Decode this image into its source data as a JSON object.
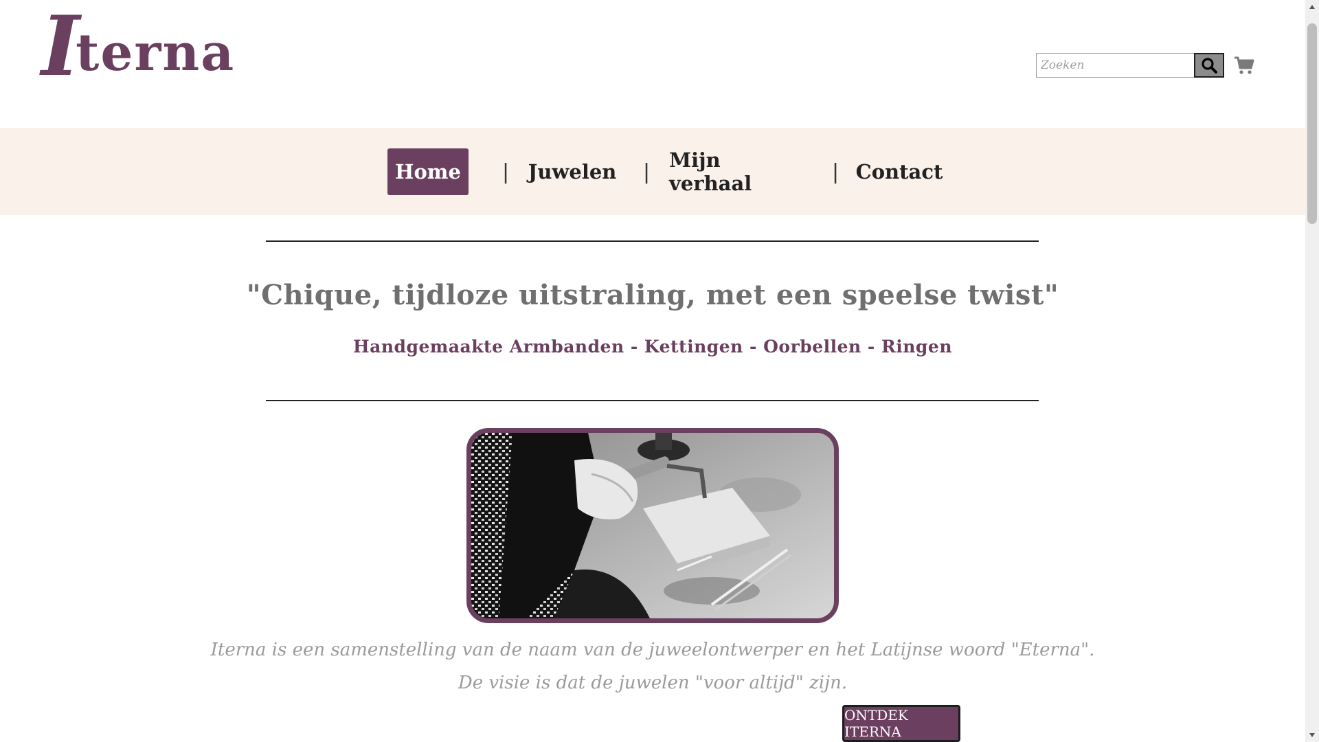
{
  "header": {
    "logo_initial": "I",
    "logo_rest": "terna",
    "search": {
      "placeholder": "Zoeken",
      "value": ""
    },
    "icons": {
      "search": "search-icon",
      "cart": "shopping-cart-icon"
    }
  },
  "nav": {
    "items": [
      {
        "label": "Home",
        "active": true
      },
      {
        "label": "Juwelen",
        "active": false
      },
      {
        "label": "Mijn verhaal",
        "active": false
      },
      {
        "label": "Contact",
        "active": false
      }
    ],
    "separator": "|"
  },
  "hero": {
    "quote": "\"Chique, tijdloze uitstraling, met een speelse twist\"",
    "subtitle": "Handgemaakte Armbanden - Kettingen - Oorbellen - Ringen"
  },
  "intro": {
    "line1": "Iterna is een samenstelling van de naam van de juweelontwerper en het Latijnse woord \"Eterna\".",
    "line2": "De visie is dat de juwelen \"voor altijd\" zijn."
  },
  "cta": {
    "label": "ONTDEK ITERNA"
  },
  "colors": {
    "brand": "#6b3f5f",
    "nav_background": "#faf1eb",
    "quote_text": "#6f6f6f",
    "intro_text": "#9a9a9a"
  }
}
